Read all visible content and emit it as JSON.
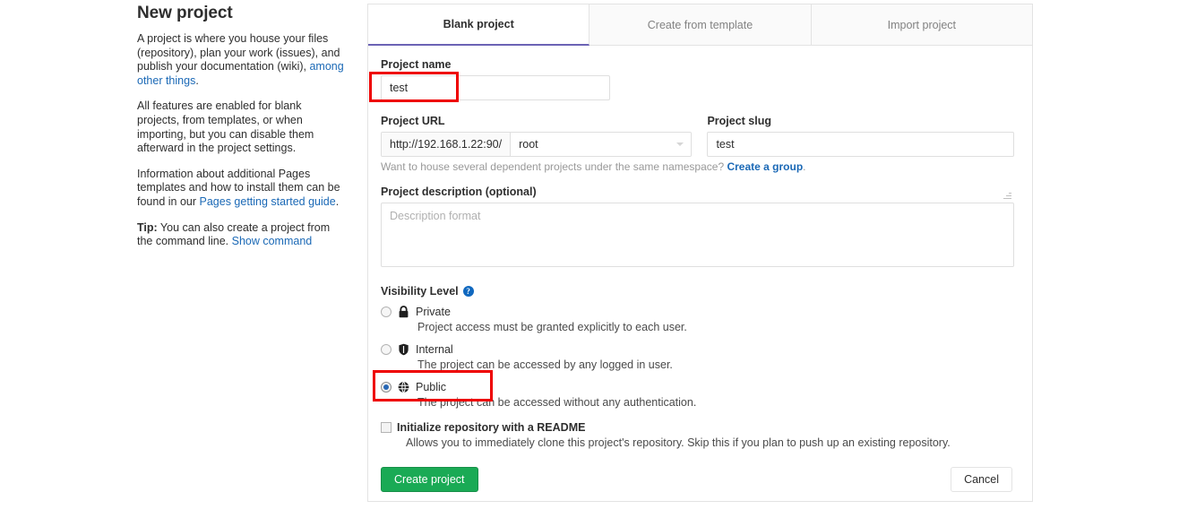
{
  "sidebar": {
    "title": "New project",
    "paragraphs": [
      {
        "id": "p1",
        "pre": "A project is where you house your files (repository), plan your work (issues), and publish your documentation (wiki), ",
        "link": "among other things",
        "post": "."
      },
      {
        "id": "p2",
        "pre": "All features are enabled for blank projects, from templates, or when importing, but you can disable them afterward in the project settings.",
        "link": "",
        "post": ""
      },
      {
        "id": "p3",
        "pre": "Information about additional Pages templates and how to install them can be found in our ",
        "link": "Pages getting started guide",
        "post": "."
      }
    ],
    "tip_label": "Tip:",
    "tip_text": " You can also create a project from the command line. ",
    "tip_link": "Show command"
  },
  "tabs": [
    {
      "label": "Blank project",
      "active": true
    },
    {
      "label": "Create from template",
      "active": false
    },
    {
      "label": "Import project",
      "active": false
    }
  ],
  "form": {
    "project_name": {
      "label": "Project name",
      "value": "test",
      "placeholder": ""
    },
    "project_url": {
      "label": "Project URL",
      "prefix": "http://192.168.1.22:90/",
      "namespace": "root",
      "chevron_icon": "chevron-down-icon"
    },
    "project_slug": {
      "label": "Project slug",
      "value": "test",
      "placeholder": ""
    },
    "namespace_help": {
      "text": "Want to house several dependent projects under the same namespace? ",
      "link": "Create a group",
      "post": "."
    },
    "description": {
      "label": "Project description (optional)",
      "value": "",
      "placeholder": "Description format"
    },
    "visibility": {
      "label": "Visibility Level",
      "help_icon": "question-mark-help-icon",
      "options": [
        {
          "name": "Private",
          "icon": "lock-icon",
          "description": "Project access must be granted explicitly to each user.",
          "selected": false
        },
        {
          "name": "Internal",
          "icon": "shield-icon",
          "description": "The project can be accessed by any logged in user.",
          "selected": false
        },
        {
          "name": "Public",
          "icon": "globe-icon",
          "description": "The project can be accessed without any authentication.",
          "selected": true
        }
      ]
    },
    "readme": {
      "label": "Initialize repository with a README",
      "description": "Allows you to immediately clone this project's repository. Skip this if you plan to push up an existing repository.",
      "checked": false
    },
    "actions": {
      "submit_label": "Create project",
      "cancel_label": "Cancel"
    }
  },
  "colors": {
    "link": "#1b69b6",
    "active_tab_underline": "#6b63b5",
    "primary_button": "#1aaa55",
    "annotation": "#ee0000",
    "help_icon": "#1068bf",
    "radio_selected": "#2767b5"
  },
  "annotations": [
    {
      "target": "project-name-input",
      "color": "#ee0000"
    },
    {
      "target": "visibility-option-public",
      "color": "#ee0000"
    }
  ]
}
